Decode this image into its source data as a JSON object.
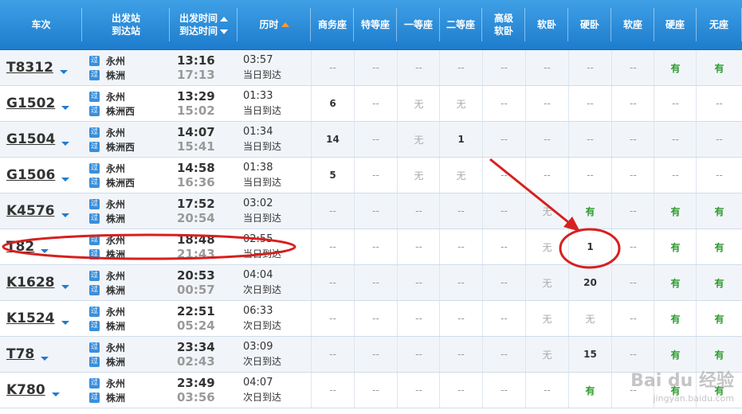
{
  "headers": {
    "train": "车次",
    "station_top": "出发站",
    "station_bottom": "到达站",
    "time_top": "出发时间",
    "time_bottom": "到达时间",
    "duration": "历时",
    "seats": [
      "商务座",
      "特等座",
      "一等座",
      "二等座",
      "高级\n软卧",
      "软卧",
      "硬卧",
      "软座",
      "硬座",
      "无座"
    ]
  },
  "route_tag": "过",
  "rows": [
    {
      "train": "T8312",
      "from": "永州",
      "to": "株洲",
      "dep": "13:16",
      "arr": "17:13",
      "dur": "03:57",
      "day": "当日到达",
      "seats": [
        "--",
        "--",
        "--",
        "--",
        "--",
        "--",
        "--",
        "--",
        "有",
        "有"
      ]
    },
    {
      "train": "G1502",
      "from": "永州",
      "to": "株洲西",
      "dep": "13:29",
      "arr": "15:02",
      "dur": "01:33",
      "day": "当日到达",
      "seats": [
        "6",
        "--",
        "无",
        "无",
        "--",
        "--",
        "--",
        "--",
        "--",
        "--"
      ]
    },
    {
      "train": "G1504",
      "from": "永州",
      "to": "株洲西",
      "dep": "14:07",
      "arr": "15:41",
      "dur": "01:34",
      "day": "当日到达",
      "seats": [
        "14",
        "--",
        "无",
        "1",
        "--",
        "--",
        "--",
        "--",
        "--",
        "--"
      ]
    },
    {
      "train": "G1506",
      "from": "永州",
      "to": "株洲西",
      "dep": "14:58",
      "arr": "16:36",
      "dur": "01:38",
      "day": "当日到达",
      "seats": [
        "5",
        "--",
        "无",
        "无",
        "--",
        "--",
        "--",
        "--",
        "--",
        "--"
      ]
    },
    {
      "train": "K4576",
      "from": "永州",
      "to": "株洲",
      "dep": "17:52",
      "arr": "20:54",
      "dur": "03:02",
      "day": "当日到达",
      "seats": [
        "--",
        "--",
        "--",
        "--",
        "--",
        "无",
        "有",
        "--",
        "有",
        "有"
      ]
    },
    {
      "train": "T82",
      "from": "永州",
      "to": "株洲",
      "dep": "18:48",
      "arr": "21:43",
      "dur": "02:55",
      "day": "当日到达",
      "seats": [
        "--",
        "--",
        "--",
        "--",
        "--",
        "无",
        "1",
        "--",
        "有",
        "有"
      ]
    },
    {
      "train": "K1628",
      "from": "永州",
      "to": "株洲",
      "dep": "20:53",
      "arr": "00:57",
      "dur": "04:04",
      "day": "次日到达",
      "seats": [
        "--",
        "--",
        "--",
        "--",
        "--",
        "无",
        "20",
        "--",
        "有",
        "有"
      ]
    },
    {
      "train": "K1524",
      "from": "永州",
      "to": "株洲",
      "dep": "22:51",
      "arr": "05:24",
      "dur": "06:33",
      "day": "次日到达",
      "seats": [
        "--",
        "--",
        "--",
        "--",
        "--",
        "无",
        "无",
        "--",
        "有",
        "有"
      ]
    },
    {
      "train": "T78",
      "from": "永州",
      "to": "株洲",
      "dep": "23:34",
      "arr": "02:43",
      "dur": "03:09",
      "day": "次日到达",
      "seats": [
        "--",
        "--",
        "--",
        "--",
        "--",
        "无",
        "15",
        "--",
        "有",
        "有"
      ]
    },
    {
      "train": "K780",
      "from": "永州",
      "to": "株洲",
      "dep": "23:49",
      "arr": "03:56",
      "dur": "04:07",
      "day": "次日到达",
      "seats": [
        "--",
        "--",
        "--",
        "--",
        "--",
        "--",
        "有",
        "--",
        "有",
        "有"
      ]
    }
  ],
  "watermark": {
    "brand": "Bai du 经验",
    "url": "jingyan.baidu.com"
  },
  "colors": {
    "header": "#2b8ad8",
    "available": "#2d9a2d",
    "annotation": "#d6201f"
  }
}
